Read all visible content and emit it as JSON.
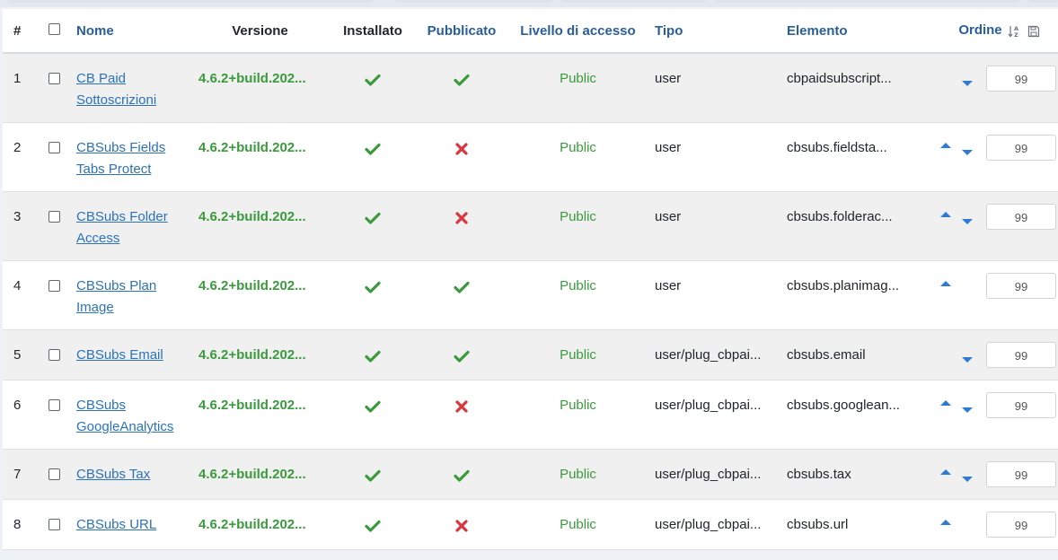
{
  "columns": {
    "num": "#",
    "name": "Nome",
    "version": "Versione",
    "installed": "Installato",
    "published": "Pubblicato",
    "access": "Livello di accesso",
    "type": "Tipo",
    "element": "Elemento",
    "order": "Ordine"
  },
  "icons": {
    "check_color": "#3a9a3c",
    "cross_color": "#d9363e",
    "arrow_color": "#2e7bd6",
    "sort_icon": "sort-icon",
    "save_icon": "save-icon"
  },
  "rows": [
    {
      "num": "1",
      "name": "CB Paid Sottoscrizioni",
      "version": "4.6.2+build.202...",
      "installed": true,
      "published": true,
      "access": "Public",
      "type": "user",
      "element": "cbpaidsubscript...",
      "up": false,
      "down": true,
      "order": "99"
    },
    {
      "num": "2",
      "name": "CBSubs Fields Tabs Protect",
      "version": "4.6.2+build.202...",
      "installed": true,
      "published": false,
      "access": "Public",
      "type": "user",
      "element": "cbsubs.fieldsta...",
      "up": true,
      "down": true,
      "order": "99"
    },
    {
      "num": "3",
      "name": "CBSubs Folder Access",
      "version": "4.6.2+build.202...",
      "installed": true,
      "published": false,
      "access": "Public",
      "type": "user",
      "element": "cbsubs.folderac...",
      "up": true,
      "down": true,
      "order": "99"
    },
    {
      "num": "4",
      "name": "CBSubs Plan Image",
      "version": "4.6.2+build.202...",
      "installed": true,
      "published": true,
      "access": "Public",
      "type": "user",
      "element": "cbsubs.planimag...",
      "up": true,
      "down": false,
      "order": "99"
    },
    {
      "num": "5",
      "name": "CBSubs Email",
      "version": "4.6.2+build.202...",
      "installed": true,
      "published": true,
      "access": "Public",
      "type": "user/plug_cbpai...",
      "element": "cbsubs.email",
      "up": false,
      "down": true,
      "order": "99"
    },
    {
      "num": "6",
      "name": "CBSubs GoogleAnalytics",
      "version": "4.6.2+build.202...",
      "installed": true,
      "published": false,
      "access": "Public",
      "type": "user/plug_cbpai...",
      "element": "cbsubs.googlean...",
      "up": true,
      "down": true,
      "order": "99"
    },
    {
      "num": "7",
      "name": "CBSubs Tax",
      "version": "4.6.2+build.202...",
      "installed": true,
      "published": true,
      "access": "Public",
      "type": "user/plug_cbpai...",
      "element": "cbsubs.tax",
      "up": true,
      "down": true,
      "order": "99"
    },
    {
      "num": "8",
      "name": "CBSubs URL",
      "version": "4.6.2+build.202...",
      "installed": true,
      "published": false,
      "access": "Public",
      "type": "user/plug_cbpai...",
      "element": "cbsubs.url",
      "up": true,
      "down": false,
      "order": "99"
    }
  ]
}
